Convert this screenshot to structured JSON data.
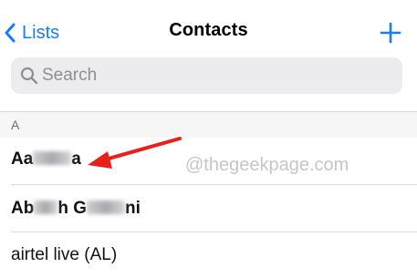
{
  "nav": {
    "back_label": "Lists",
    "title": "Contacts",
    "back_icon": "chevron-left-icon",
    "add_icon": "plus-icon"
  },
  "search": {
    "placeholder": "Search",
    "value": "",
    "icon": "search-icon"
  },
  "section": {
    "letter": "A"
  },
  "contacts": [
    {
      "visible_prefix": "Aa",
      "visible_suffix": "a"
    },
    {
      "visible_prefix": "Ab",
      "visible_middle": "h G",
      "visible_suffix": "ni"
    },
    {
      "name": "airtel live (AL)"
    }
  ],
  "watermark": "@thegeekpage.com",
  "colors": {
    "accent": "#147efb",
    "annotation_arrow": "#e8201a"
  }
}
